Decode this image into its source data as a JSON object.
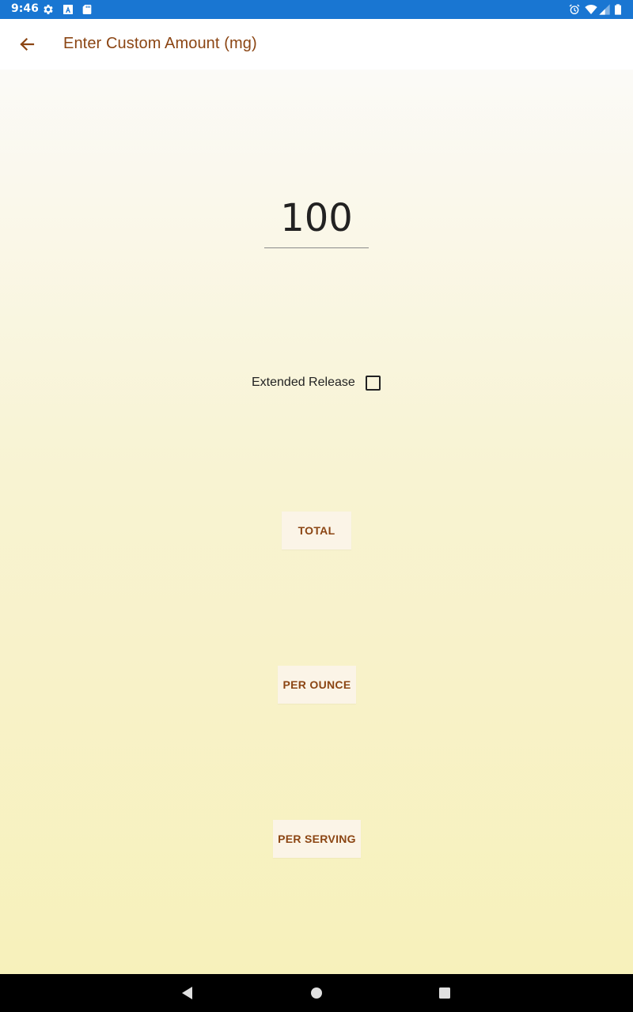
{
  "status_bar": {
    "time": "9:46",
    "background": "#1976d2",
    "left_icons": [
      "settings-icon",
      "font-icon",
      "sd-card-icon"
    ],
    "right_icons": [
      "alarm-icon",
      "wifi-icon",
      "signal-icon",
      "battery-icon"
    ]
  },
  "app_bar": {
    "title": "Enter Custom Amount (mg)",
    "back_icon": "arrow-back-icon",
    "title_color": "#8b4513"
  },
  "amount_input": {
    "value": "100"
  },
  "extended_release": {
    "label": "Extended Release",
    "checked": false
  },
  "buttons": {
    "total": "TOTAL",
    "per_ounce": "PER OUNCE",
    "per_serving": "PER SERVING"
  },
  "nav_bar": {
    "back_icon": "nav-back-icon",
    "home_icon": "nav-home-icon",
    "recents_icon": "nav-recents-icon"
  }
}
